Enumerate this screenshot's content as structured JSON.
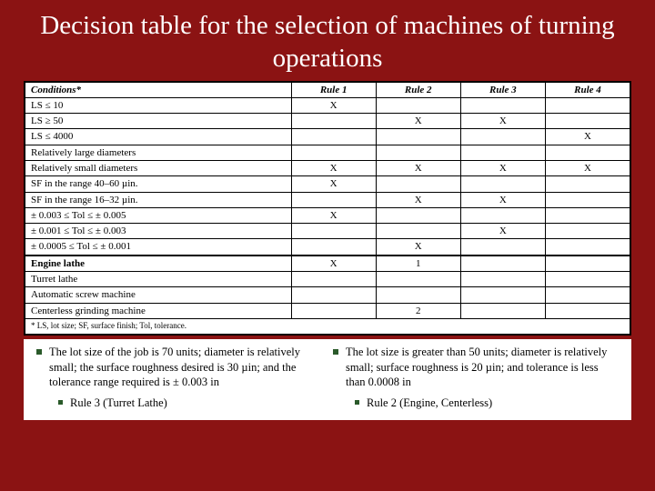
{
  "title": "Decision table for the selection of machines of turning operations",
  "table": {
    "headers": [
      "Conditions*",
      "Rule 1",
      "Rule 2",
      "Rule 3",
      "Rule 4"
    ],
    "rows": [
      {
        "c": "LS ≤ 10",
        "r": [
          "X",
          "",
          "",
          ""
        ]
      },
      {
        "c": "LS ≥ 50",
        "r": [
          "",
          "X",
          "X",
          ""
        ]
      },
      {
        "c": "LS ≤ 4000",
        "r": [
          "",
          "",
          "",
          "X"
        ]
      },
      {
        "c": "Relatively large diameters",
        "r": [
          "",
          "",
          "",
          ""
        ]
      },
      {
        "c": "Relatively small diameters",
        "r": [
          "X",
          "X",
          "X",
          "X"
        ]
      },
      {
        "c": "SF in the range 40–60 µin.",
        "r": [
          "X",
          "",
          "",
          ""
        ]
      },
      {
        "c": "SF in the range 16–32 µin.",
        "r": [
          "",
          "X",
          "X",
          ""
        ]
      },
      {
        "c": "± 0.003 ≤ Tol ≤ ± 0.005",
        "r": [
          "X",
          "",
          "",
          ""
        ]
      },
      {
        "c": "± 0.001 ≤ Tol ≤ ± 0.003",
        "r": [
          "",
          "",
          "X",
          ""
        ]
      },
      {
        "c": "± 0.0005 ≤ Tol ≤ ± 0.001",
        "r": [
          "",
          "X",
          "",
          ""
        ]
      }
    ],
    "actions": [
      {
        "c": "Engine lathe",
        "r": [
          "X",
          "1",
          "",
          ""
        ]
      },
      {
        "c": "Turret lathe",
        "r": [
          "",
          "",
          "",
          ""
        ]
      },
      {
        "c": "Automatic screw machine",
        "r": [
          "",
          "",
          "",
          ""
        ]
      },
      {
        "c": "Centerless grinding machine",
        "r": [
          "",
          "2",
          "",
          ""
        ]
      }
    ],
    "footnote": "* LS, lot size; SF, surface finish; Tol, tolerance."
  },
  "bullets": {
    "left": {
      "main": "The lot size of the job is 70 units; diameter is relatively small; the surface roughness desired is 30 µin; and the tolerance range required is ± 0.003 in",
      "sub": "Rule 3 (Turret Lathe)"
    },
    "right": {
      "main": "The lot size is greater than 50 units; diameter is relatively small; surface roughness is 20 µin; and tolerance is less than 0.0008 in",
      "sub": "Rule 2 (Engine, Centerless)"
    }
  }
}
